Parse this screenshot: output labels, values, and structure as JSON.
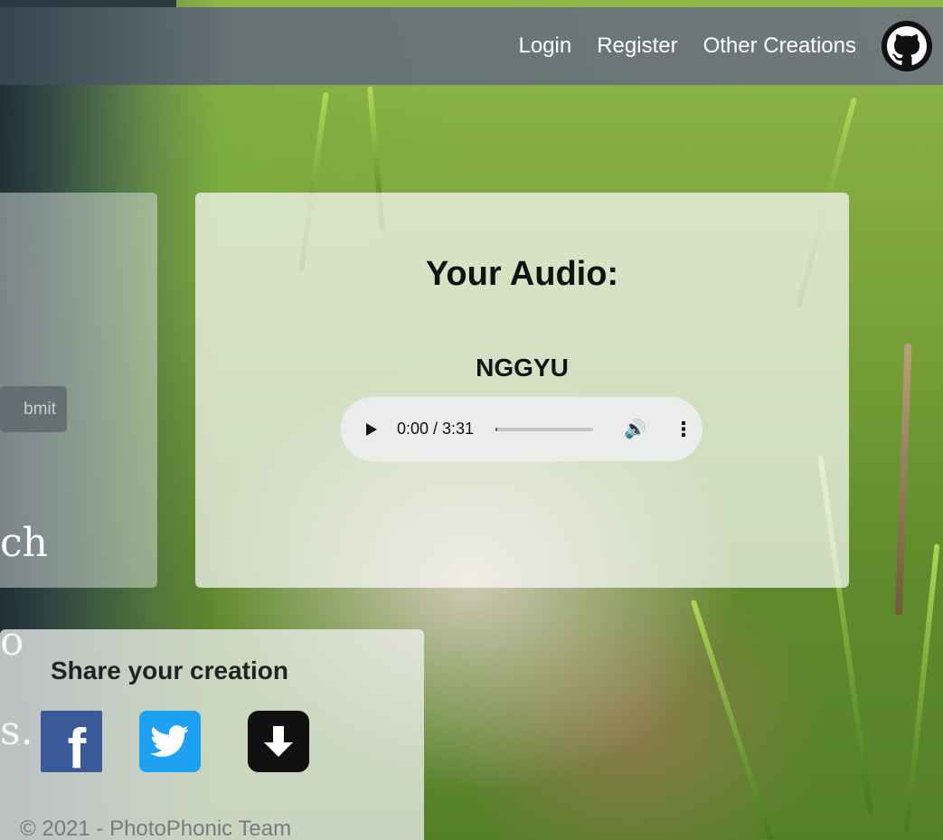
{
  "navbar": {
    "links": [
      {
        "label": "Login"
      },
      {
        "label": "Register"
      },
      {
        "label": "Other Creations"
      }
    ],
    "github_icon": "github-icon"
  },
  "form": {
    "submit_label": "bmit"
  },
  "left_text": {
    "line1": "ch",
    "line2": "o",
    "line3": "s."
  },
  "audio": {
    "title": "Your Audio:",
    "track_name": "NGGYU",
    "current_time": "0:00",
    "duration": "3:31",
    "time_display": "0:00 / 3:31",
    "progress": 0.02
  },
  "share": {
    "title": "Share your creation",
    "icons": [
      "facebook-icon",
      "twitter-icon",
      "download-icon"
    ]
  },
  "footer": {
    "text": "© 2021 - PhotoPhonic Team"
  },
  "colors": {
    "facebook": "#3b5998",
    "twitter": "#1da1f2",
    "navbar": "#6e767d"
  }
}
